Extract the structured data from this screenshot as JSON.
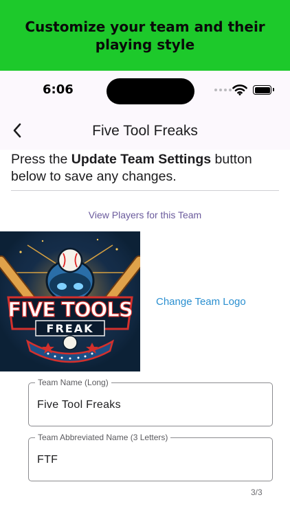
{
  "banner": {
    "text": "Customize your team and their playing style"
  },
  "status_bar": {
    "time": "6:06"
  },
  "nav": {
    "title": "Five Tool Freaks",
    "back_icon": "chevron-left-icon"
  },
  "instructions": {
    "prefix": "Press the ",
    "button_name": "Update Team Settings",
    "suffix": " button below to save any changes."
  },
  "links": {
    "view_players": "View Players for this Team",
    "change_logo": "Change Team Logo"
  },
  "logo": {
    "word1": "FIVE",
    "word2": "TOOLS",
    "word3": "FREAK"
  },
  "fields": {
    "long_name": {
      "label": "Team Name (Long)",
      "value": "Five Tool Freaks"
    },
    "abbr_name": {
      "label": "Team Abbreviated Name (3 Letters)",
      "value": "FTF"
    }
  },
  "counter": "3/3",
  "colors": {
    "banner": "#1dc92b",
    "link_purple": "#6a5a9c",
    "link_blue": "#2a8fd0"
  }
}
